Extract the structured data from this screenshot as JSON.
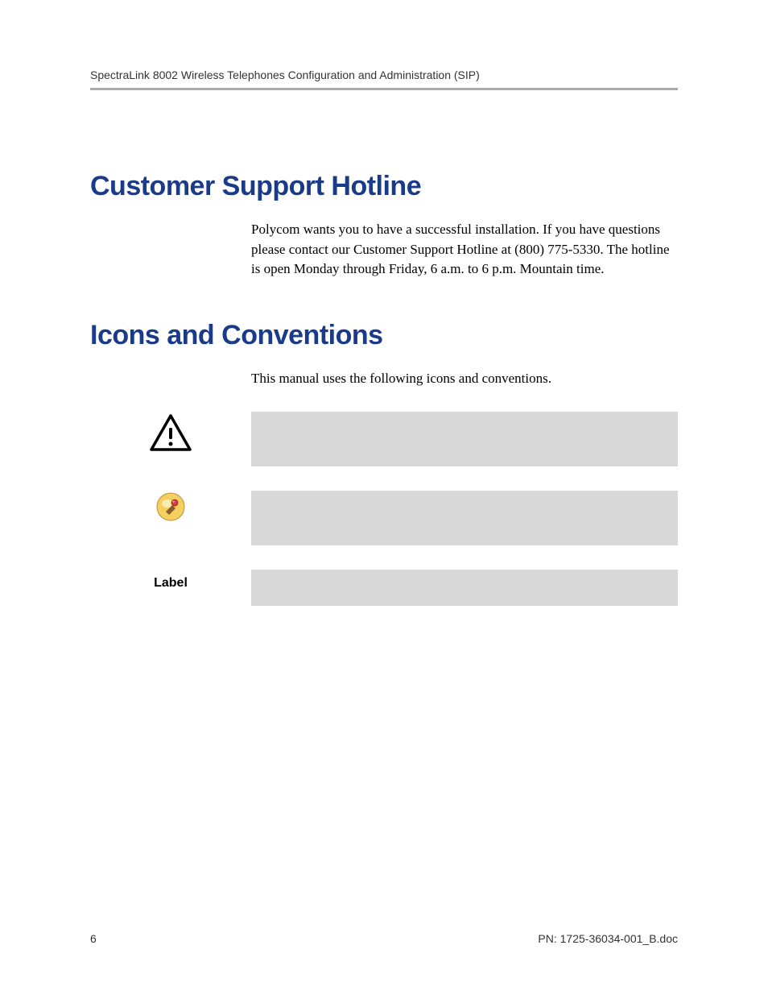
{
  "header": {
    "title": "SpectraLink 8002 Wireless Telephones Configuration and Administration (SIP)"
  },
  "sections": {
    "hotline": {
      "heading": "Customer Support Hotline",
      "body": "Polycom wants you to have a successful installation. If you have questions please contact our Customer Support Hotline at (800) 775-5330. The hotline is open Monday through Friday, 6 a.m. to 6 p.m. Mountain time."
    },
    "icons": {
      "heading": "Icons and Conventions",
      "intro": "This manual uses the following icons and conventions.",
      "label_text": "Label"
    }
  },
  "footer": {
    "page_number": "6",
    "doc_id": "PN: 1725-36034-001_B.doc"
  }
}
